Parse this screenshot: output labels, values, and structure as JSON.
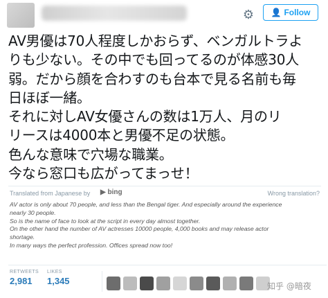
{
  "header": {
    "follow_label": "Follow",
    "gear_icon": "gear-icon",
    "follow_icon": "person-plus-icon"
  },
  "tweet": {
    "lines": [
      "AV男優は70人程度しかおらず、ベンガルトラよ",
      "りも少ない。その中でも回ってるのが体感30人",
      "弱。だから顔を合わすのも台本で見る名前も毎",
      "日ほぼ一緒。",
      "それに対しAV女優さんの数は1万人、月のリ",
      "リースは4000本と男優不足の状態。",
      "色んな意味で穴場な職業。",
      "今なら窓口も広がってまっせ！"
    ]
  },
  "translation_bar": {
    "from_label": "Translated from Japanese by",
    "provider": "bing",
    "wrong_label": "Wrong translation?"
  },
  "translation": {
    "lines": [
      "AV actor is only about 70 people, and less than the Bengal tiger. And especially around the experience",
      "nearly 30 people.",
      "So is the name of face to look at the script in every day almost together.",
      "On the other hand the number of AV actresses 10000 people, 4,000 books and may release actor",
      "shortage.",
      "In many ways the perfect profession. Offices spread now too!"
    ]
  },
  "stats": {
    "retweets_label": "RETWEETS",
    "retweets_value": "2,981",
    "likes_label": "LIKES",
    "likes_value": "1,345"
  },
  "watermark": "知乎 @暗夜",
  "colors": {
    "accent": "#1da1f2",
    "stat_value": "#2b7bb9"
  }
}
